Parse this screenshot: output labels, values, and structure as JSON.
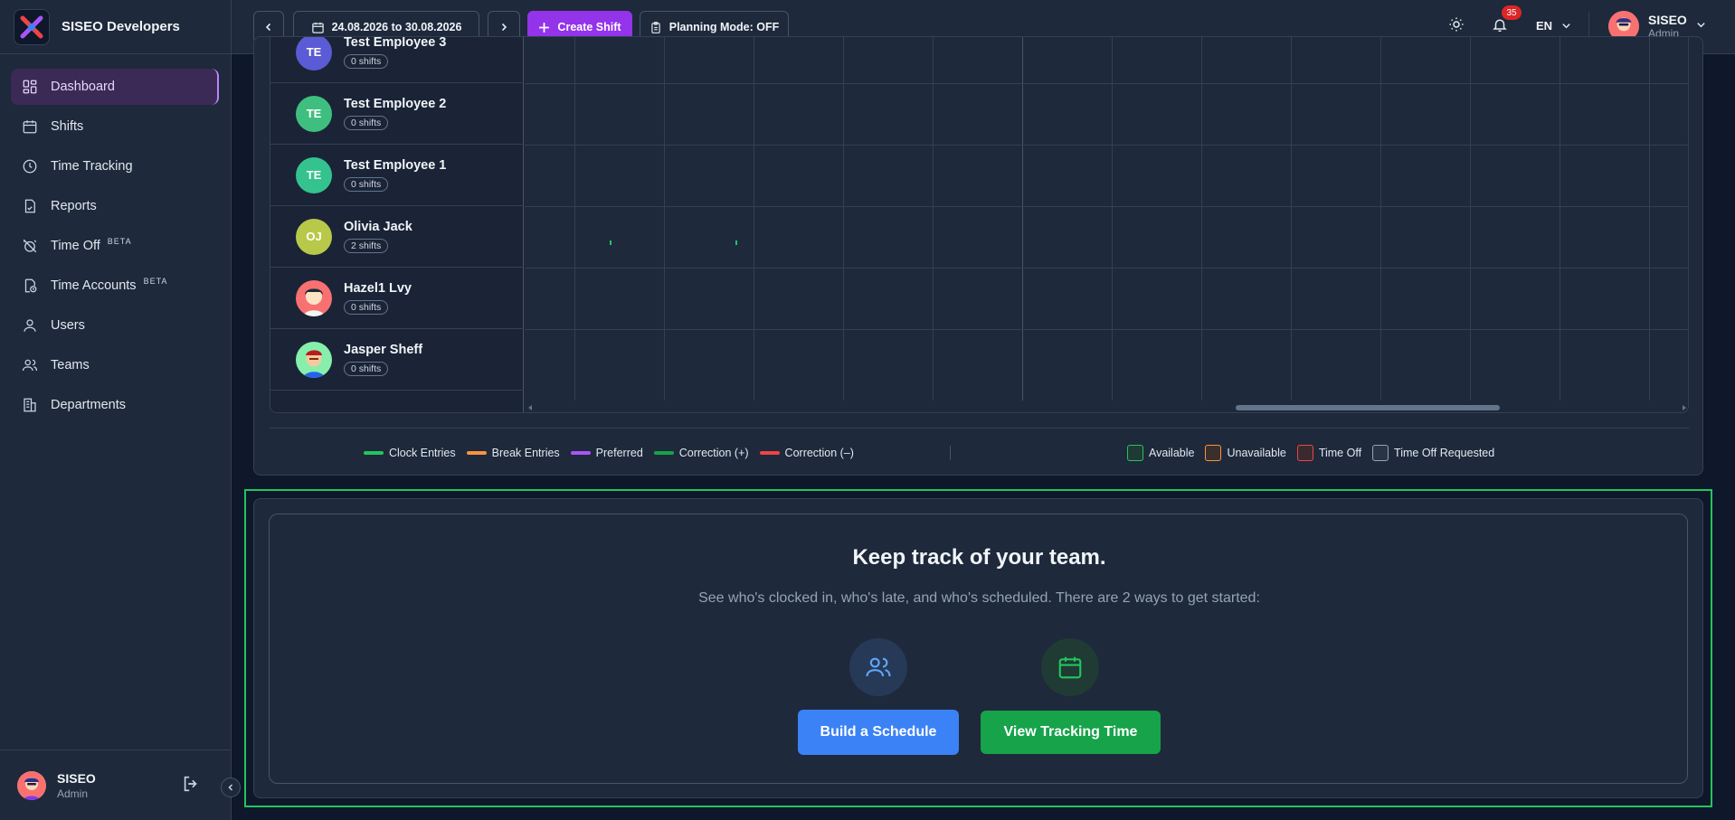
{
  "app": {
    "name": "SISEO Developers"
  },
  "sidebar": {
    "items": [
      {
        "label": "Dashboard",
        "icon": "dashboard-icon",
        "active": true
      },
      {
        "label": "Shifts",
        "icon": "calendar-icon"
      },
      {
        "label": "Time Tracking",
        "icon": "clock-icon"
      },
      {
        "label": "Reports",
        "icon": "report-icon"
      },
      {
        "label": "Time Off",
        "icon": "alarm-off-icon",
        "badge": "BETA"
      },
      {
        "label": "Time Accounts",
        "icon": "time-account-icon",
        "badge": "BETA"
      },
      {
        "label": "Users",
        "icon": "user-icon"
      },
      {
        "label": "Teams",
        "icon": "teams-icon"
      },
      {
        "label": "Departments",
        "icon": "building-icon"
      }
    ],
    "user": {
      "name": "SISEO",
      "role": "Admin"
    }
  },
  "topbar": {
    "date_range": "24.08.2026 to 30.08.2026",
    "create_shift": "Create Shift",
    "planning_mode": "Planning Mode: OFF",
    "notifications": "35",
    "language": "EN",
    "user": {
      "name": "SISEO",
      "role": "Admin"
    }
  },
  "schedule": {
    "employees": [
      {
        "initials": "TE",
        "name": "Test Employee 3",
        "shifts": "0 shifts",
        "color": "#5b5bd6"
      },
      {
        "initials": "TE",
        "name": "Test Employee 2",
        "shifts": "0 shifts",
        "color": "#3fbf7f"
      },
      {
        "initials": "TE",
        "name": "Test Employee 1",
        "shifts": "0 shifts",
        "color": "#34c38f"
      },
      {
        "initials": "OJ",
        "name": "Olivia Jack",
        "shifts": "2 shifts",
        "color": "#b8c94a"
      },
      {
        "initials": "",
        "name": "Hazel1 Lvy",
        "shifts": "0 shifts",
        "color": "#f87171"
      },
      {
        "initials": "",
        "name": "Jasper Sheff",
        "shifts": "0 shifts",
        "color": "#86efac"
      }
    ]
  },
  "legend": {
    "lines": [
      {
        "label": "Clock Entries",
        "color": "#22c55e"
      },
      {
        "label": "Break Entries",
        "color": "#fb923c"
      },
      {
        "label": "Preferred",
        "color": "#a855f7"
      },
      {
        "label": "Correction (+)",
        "color": "#16a34a"
      },
      {
        "label": "Correction (–)",
        "color": "#ef4444"
      }
    ],
    "boxes": [
      {
        "label": "Available",
        "color": "#22c55e"
      },
      {
        "label": "Unavailable",
        "color": "#fb923c"
      },
      {
        "label": "Time Off",
        "color": "#ef4444"
      },
      {
        "label": "Time Off Requested",
        "color": "#94a3b8"
      }
    ]
  },
  "get_started": {
    "title": "Keep track of your team.",
    "subtitle": "See who's clocked in, who's late, and who's scheduled. There are 2 ways to get started:",
    "build_schedule": "Build a Schedule",
    "view_tracking": "View Tracking Time"
  }
}
